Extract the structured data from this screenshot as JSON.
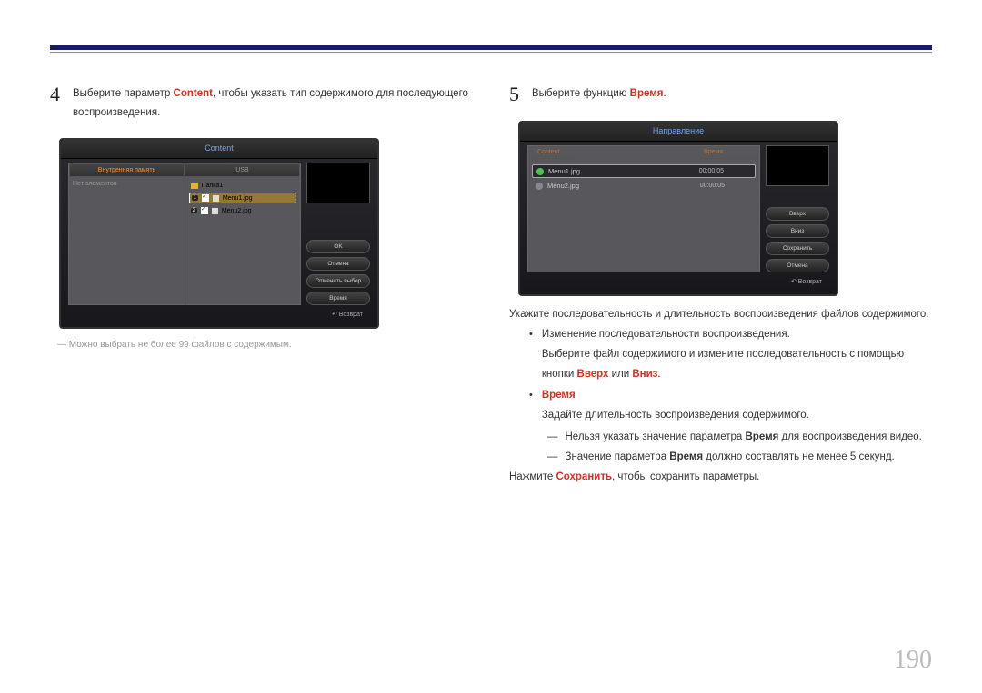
{
  "page_number": "190",
  "left": {
    "step_num": "4",
    "step_text_1": "Выберите параметр ",
    "step_text_red": "Content",
    "step_text_2": ", чтобы указать тип содержимого для последующего воспроизведения.",
    "note": "Можно выбрать не более 99 файлов с содержимым.",
    "panel": {
      "title": "Content",
      "tab1": "Внутренняя память",
      "tab2": "USB",
      "no_items": "Нет элементов",
      "folder": "Папка1",
      "file1": "Menu1.jpg",
      "file2": "Menu2.jpg",
      "n1": "1",
      "n2": "2",
      "btn_ok": "OK",
      "btn_cancel": "Отмена",
      "btn_deselect": "Отменить выбор",
      "btn_time": "Время",
      "return": "Возврат"
    }
  },
  "right": {
    "step_num": "5",
    "step_text_1": "Выберите функцию ",
    "step_text_red": "Время",
    "step_text_2": ".",
    "panel": {
      "title": "Направление",
      "col1": "Content",
      "col2": "Время",
      "file1": "Menu1.jpg",
      "file2": "Menu2.jpg",
      "t1": "00:00:05",
      "t2": "00:00:05",
      "btn_up": "Вверх",
      "btn_down": "Вниз",
      "btn_save": "Сохранить",
      "btn_cancel": "Отмена",
      "return": "Возврат"
    },
    "p1": "Укажите последовательность и длительность воспроизведения файлов содержимого.",
    "b1_title": "Изменение последовательности воспроизведения.",
    "b1_text_1": "Выберите файл содержимого и измените последовательность с помощью кнопки ",
    "b1_red1": "Вверх",
    "b1_mid": " или ",
    "b1_red2": "Вниз",
    "b1_end": ".",
    "b2_title": "Время",
    "b2_text": "Задайте длительность воспроизведения содержимого.",
    "sub1_1": "Нельзя указать значение параметра ",
    "sub1_red": "Время",
    "sub1_2": " для воспроизведения видео.",
    "sub2_1": "Значение параметра ",
    "sub2_red": "Время",
    "sub2_2": " должно составлять не менее 5 секунд.",
    "p2_1": "Нажмите ",
    "p2_red": "Сохранить",
    "p2_2": ", чтобы сохранить параметры."
  }
}
